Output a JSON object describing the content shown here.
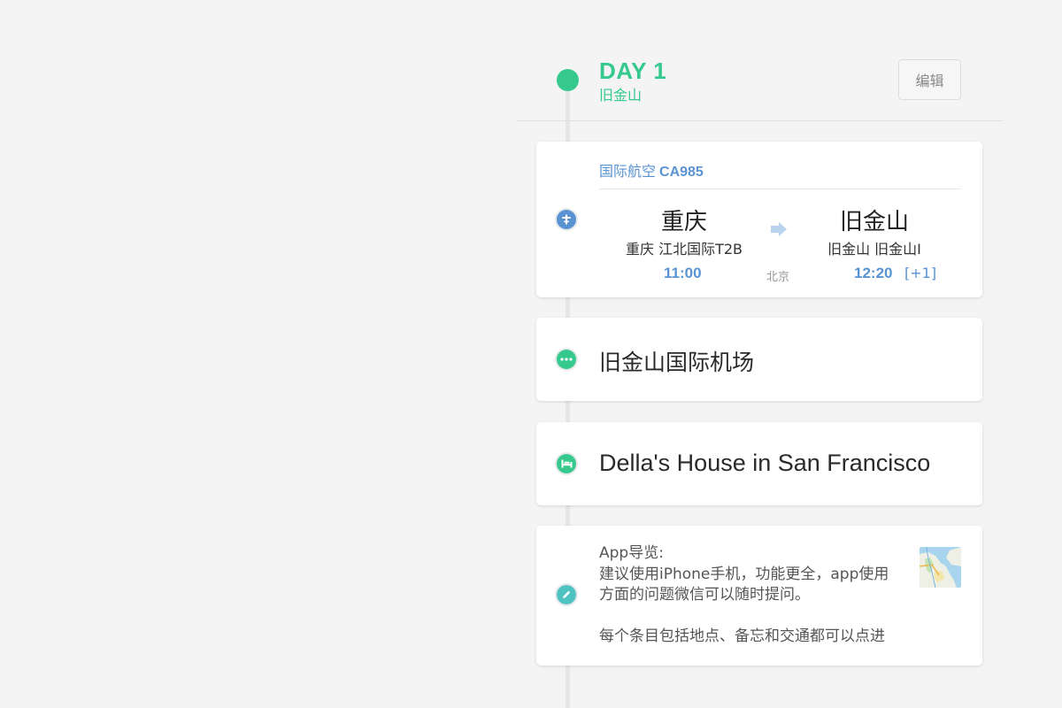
{
  "day": {
    "title": "DAY 1",
    "city": "旧金山",
    "edit_label": "编辑"
  },
  "flight": {
    "airline": "国际航空",
    "code": "CA985",
    "from_city": "重庆",
    "from_airport": "重庆 江北国际T2B",
    "depart_time": "11:00",
    "timezone_label": "北京",
    "to_city": "旧金山",
    "to_airport": "旧金山 旧金山I",
    "arrive_time": "12:20",
    "day_offset": "[+1]",
    "icon": "flight-icon"
  },
  "place": {
    "name": "旧金山国际机场",
    "icon": "more-dots-icon"
  },
  "hotel": {
    "name": "Della's House in San Francisco",
    "icon": "bed-icon"
  },
  "note": {
    "line1": "App导览:",
    "line2": "建议使用iPhone手机，功能更全，app使用",
    "line3": "方面的问题微信可以随时提问。",
    "line4": "每个条目包括地点、备忘和交通都可以点进",
    "icon": "pencil-icon"
  },
  "colors": {
    "accent_green": "#35c98e",
    "accent_blue": "#5a93d1",
    "note_teal": "#4fc3c1"
  }
}
